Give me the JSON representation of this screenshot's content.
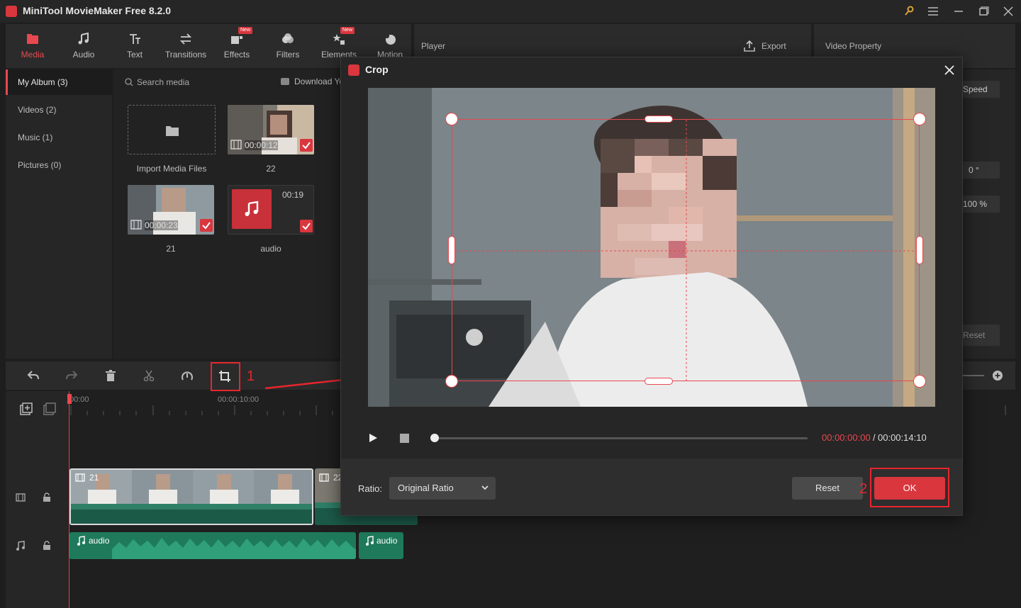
{
  "app": {
    "title": "MiniTool MovieMaker Free 8.2.0"
  },
  "toolbar": {
    "items": [
      {
        "label": "Media",
        "icon": "media-icon",
        "active": true,
        "badge": ""
      },
      {
        "label": "Audio",
        "icon": "music-note-icon",
        "active": false,
        "badge": ""
      },
      {
        "label": "Text",
        "icon": "text-icon",
        "active": false,
        "badge": ""
      },
      {
        "label": "Transitions",
        "icon": "transitions-icon",
        "active": false,
        "badge": ""
      },
      {
        "label": "Effects",
        "icon": "effects-icon",
        "active": false,
        "badge": "New"
      },
      {
        "label": "Filters",
        "icon": "filters-icon",
        "active": false,
        "badge": ""
      },
      {
        "label": "Elements",
        "icon": "elements-icon",
        "active": false,
        "badge": "New"
      },
      {
        "label": "Motion",
        "icon": "motion-icon",
        "active": false,
        "badge": ""
      }
    ]
  },
  "player": {
    "title": "Player",
    "export_label": "Export"
  },
  "property": {
    "title": "Video Property",
    "speed_label": "Speed",
    "rotation": "0 °",
    "scale": "100 %",
    "reset_label": "Reset"
  },
  "album": {
    "items": [
      {
        "label": "My Album (3)",
        "active": true
      },
      {
        "label": "Videos (2)",
        "active": false
      },
      {
        "label": "Music (1)",
        "active": false
      },
      {
        "label": "Pictures (0)",
        "active": false
      }
    ]
  },
  "media": {
    "search_placeholder": "Search media",
    "download_label": "Download YouTube Videos",
    "import_label": "Import Media Files",
    "items": [
      {
        "caption": "22",
        "duration": "00:00:12"
      },
      {
        "caption": "21",
        "duration": "00:00:23"
      },
      {
        "caption": "audio",
        "duration": "00:19"
      }
    ]
  },
  "timeline": {
    "ruler": [
      "00:00",
      "00:00:10:00"
    ],
    "video_clips": [
      "21",
      "22"
    ],
    "audio_clips": [
      "audio",
      "audio"
    ]
  },
  "crop": {
    "title": "Crop",
    "time_current": "00:00:00:00",
    "time_separator": "/",
    "time_total": "00:00:14:10",
    "ratio_label": "Ratio:",
    "ratio_value": "Original Ratio",
    "reset_label": "Reset",
    "ok_label": "OK"
  },
  "annotations": {
    "step1": "1",
    "step2": "2"
  },
  "colors": {
    "accent": "#d9363e",
    "annotation": "#e8252d",
    "clip_green": "#1f7a5b"
  }
}
